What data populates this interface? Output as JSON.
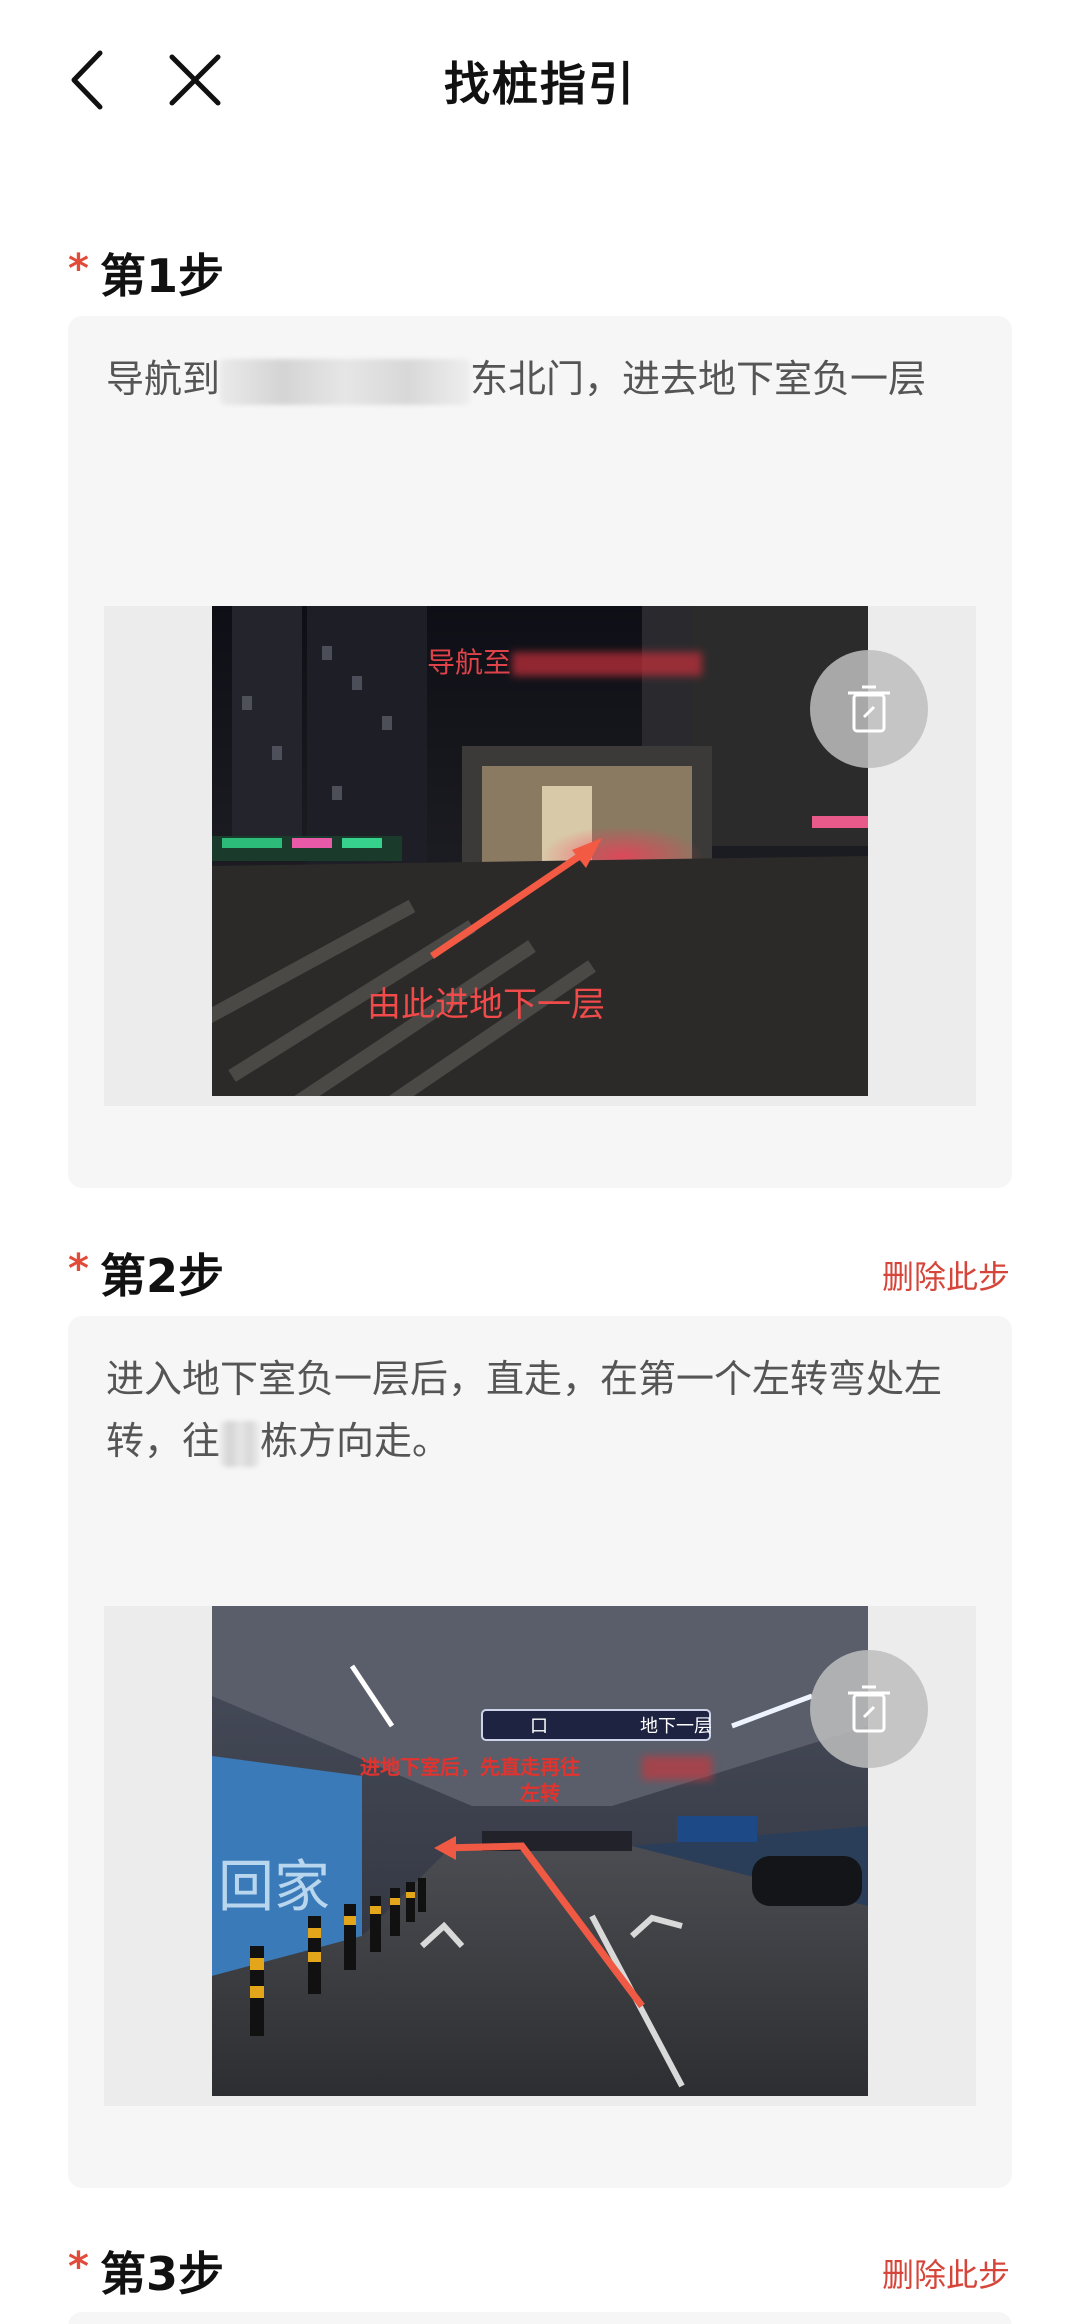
{
  "header": {
    "title": "找桩指引",
    "back_icon": "chevron-left-icon",
    "close_icon": "close-icon"
  },
  "steps": [
    {
      "asterisk": "*",
      "title": "第1步",
      "text_before": "导航到",
      "text_after": "东北门，进去地下室负一层",
      "photo": {
        "overlay_top": "导航至",
        "overlay_arrow_label": "由此进地下一层"
      },
      "delete_icon": "trash-icon"
    },
    {
      "asterisk": "*",
      "title": "第2步",
      "delete_label": "删除此步",
      "text_before": "进入地下室负一层后，直走，在第一个左转弯处左转，往",
      "text_after": "栋方向走。",
      "photo": {
        "overlay_top": "进地下室后，先直走再往",
        "overlay_top_2": "左转",
        "sign_left": "口",
        "sign_right": "地下一层",
        "wall_text": "回家"
      },
      "delete_icon": "trash-icon"
    },
    {
      "asterisk": "*",
      "title": "第3步",
      "delete_label": "删除此步"
    }
  ],
  "colors": {
    "accent": "#d6453a",
    "asterisk": "#e04b3a",
    "card_bg": "#f6f6f6"
  }
}
